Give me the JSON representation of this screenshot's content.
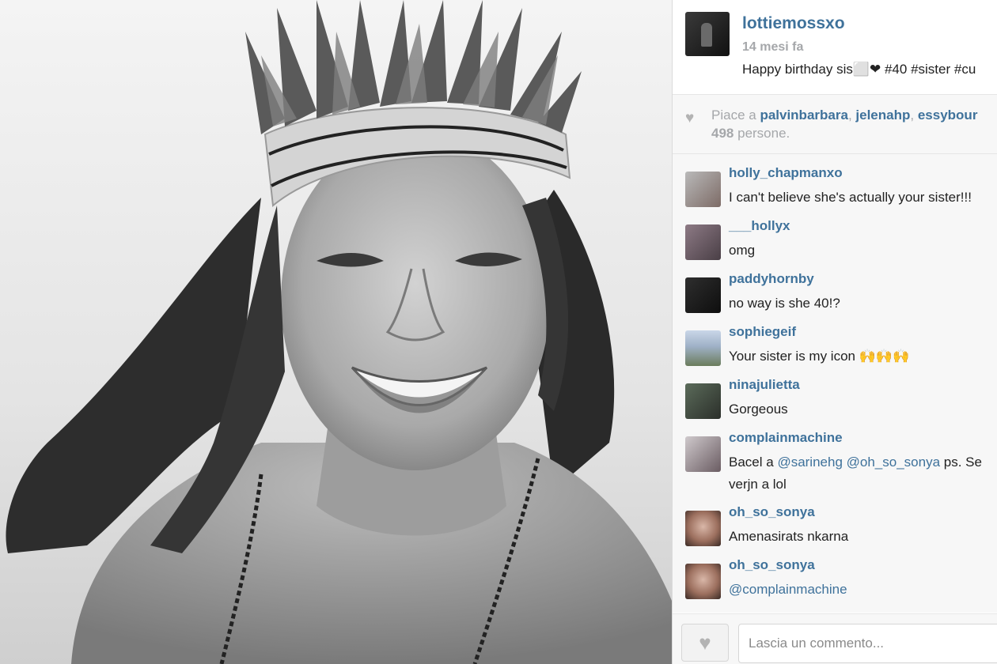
{
  "post": {
    "username": "lottiemossxo",
    "time_ago": "14 mesi fa",
    "caption": "Happy birthday sis⬜❤ #40 #sister #cu"
  },
  "likes": {
    "prefix": "Piace a",
    "users": [
      "palvinbarbara",
      "jelenahp",
      "essybour"
    ],
    "separator": ",",
    "count": "498",
    "suffix": "persone."
  },
  "comments": [
    {
      "user": "holly_chapmanxo",
      "text": "I can't believe she's actually your sister!!!"
    },
    {
      "user": "___hollyx",
      "text": "omg"
    },
    {
      "user": "paddyhornby",
      "text": "no way is she 40!?"
    },
    {
      "user": "sophiegeif",
      "text": "Your sister is my icon 🙌🙌🙌"
    },
    {
      "user": "ninajulietta",
      "text": "Gorgeous"
    },
    {
      "user": "complainmachine",
      "text_prefix": "Bacel a",
      "mention1": "@sarinehg",
      "mention2": "@oh_so_sonya",
      "text_suffix": "ps. Se",
      "text_line2": "verjn a lol"
    },
    {
      "user": "oh_so_sonya",
      "text": "Amenasirats nkarna"
    },
    {
      "user": "oh_so_sonya",
      "mention": "@complainmachine"
    }
  ],
  "comment_box": {
    "placeholder": "Lascia un commento..."
  },
  "icons": {
    "like": "heart-icon",
    "like_button": "heart-outline-icon"
  },
  "colors": {
    "link": "#3f729b",
    "muted": "#a5a7aa",
    "panel_bg": "#f7f7f7"
  }
}
